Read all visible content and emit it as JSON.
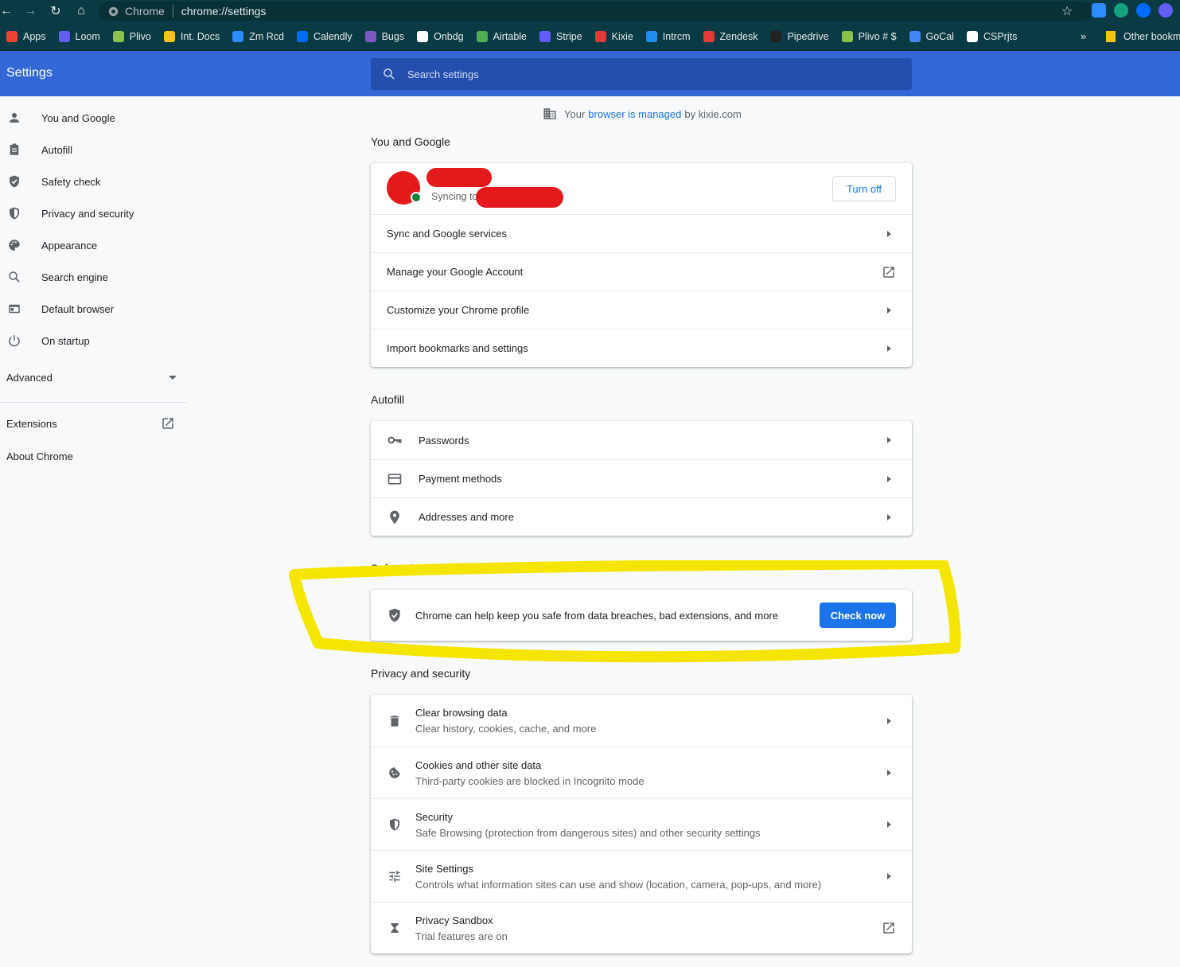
{
  "browser": {
    "tab_site": "Chrome",
    "url": "chrome://settings",
    "bookmarks": [
      {
        "label": "Apps",
        "color": "#ea4335"
      },
      {
        "label": "Loom",
        "color": "#625df5"
      },
      {
        "label": "Plivo",
        "color": "#8bc34a"
      },
      {
        "label": "Int. Docs",
        "color": "#f9c21a"
      },
      {
        "label": "Zm Rcd",
        "color": "#2d8cff"
      },
      {
        "label": "Calendly",
        "color": "#006bff"
      },
      {
        "label": "Bugs",
        "color": "#7e57c2"
      },
      {
        "label": "Onbdg",
        "color": "#ffffff"
      },
      {
        "label": "Airtable",
        "color": "#4caf50"
      },
      {
        "label": "Stripe",
        "color": "#635bff"
      },
      {
        "label": "Kixie",
        "color": "#e53935"
      },
      {
        "label": "Intrcm",
        "color": "#1f8ded"
      },
      {
        "label": "Zendesk",
        "color": "#e53935"
      },
      {
        "label": "Pipedrive",
        "color": "#222222"
      },
      {
        "label": "Plivo # $",
        "color": "#8bc34a"
      },
      {
        "label": "GoCal",
        "color": "#4285f4"
      },
      {
        "label": "CSPrjts",
        "color": "#ffffff"
      }
    ],
    "more_chevron": "»",
    "other_bookmarks": "Other bookm"
  },
  "header": {
    "title": "Settings",
    "search_placeholder": "Search settings"
  },
  "sidebar": {
    "items": [
      {
        "label": "You and Google",
        "icon": "person-icon"
      },
      {
        "label": "Autofill",
        "icon": "clipboard-icon"
      },
      {
        "label": "Safety check",
        "icon": "shield-check-icon"
      },
      {
        "label": "Privacy and security",
        "icon": "shield-icon"
      },
      {
        "label": "Appearance",
        "icon": "palette-icon"
      },
      {
        "label": "Search engine",
        "icon": "search-icon"
      },
      {
        "label": "Default browser",
        "icon": "browser-icon"
      },
      {
        "label": "On startup",
        "icon": "power-icon"
      }
    ],
    "advanced": "Advanced",
    "extensions": "Extensions",
    "about": "About Chrome"
  },
  "managed": {
    "prefix": "Your",
    "link": "browser is managed",
    "suffix": "by kixie.com"
  },
  "you_and_google": {
    "title": "You and Google",
    "syncing": "Syncing to",
    "turn_off": "Turn off",
    "rows": [
      "Sync and Google services",
      "Manage your Google Account",
      "Customize your Chrome profile",
      "Import bookmarks and settings"
    ]
  },
  "autofill": {
    "title": "Autofill",
    "rows": [
      "Passwords",
      "Payment methods",
      "Addresses and more"
    ]
  },
  "safety_check": {
    "title": "Safety check",
    "text": "Chrome can help keep you safe from data breaches, bad extensions, and more",
    "button": "Check now"
  },
  "privacy": {
    "title": "Privacy and security",
    "rows": [
      {
        "title": "Clear browsing data",
        "sub": "Clear history, cookies, cache, and more"
      },
      {
        "title": "Cookies and other site data",
        "sub": "Third-party cookies are blocked in Incognito mode"
      },
      {
        "title": "Security",
        "sub": "Safe Browsing (protection from dangerous sites) and other security settings"
      },
      {
        "title": "Site Settings",
        "sub": "Controls what information sites can use and show (location, camera, pop-ups, and more)"
      },
      {
        "title": "Privacy Sandbox",
        "sub": "Trial features are on"
      }
    ]
  },
  "colors": {
    "accent": "#1a73e8",
    "header": "#3367d6",
    "highlight": "#f5e600",
    "redaction": "#e3191b"
  }
}
